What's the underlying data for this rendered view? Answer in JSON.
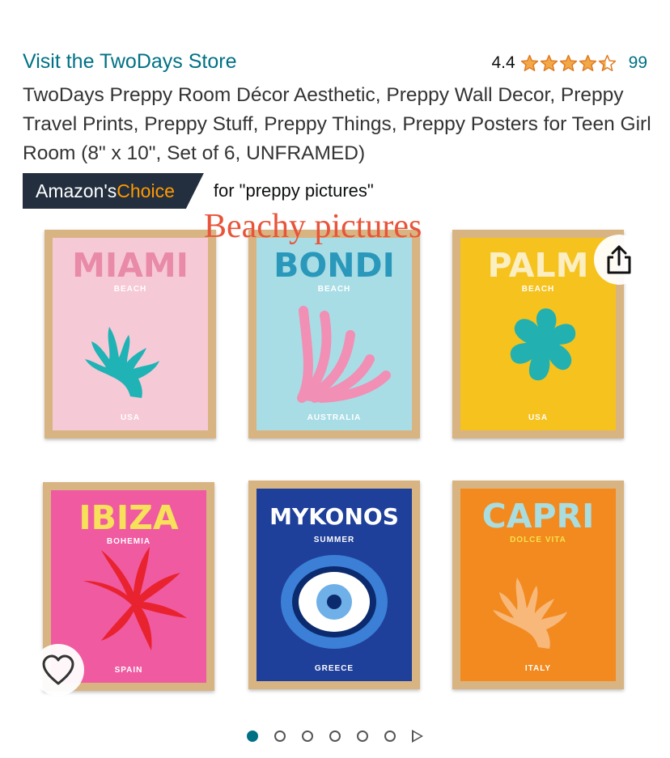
{
  "store": {
    "link_text": "Visit the TwoDays Store"
  },
  "rating": {
    "value": "4.4",
    "stars": 4.4,
    "count": "99",
    "star_color": "#f3a847"
  },
  "product": {
    "title": "TwoDays Preppy Room Décor Aesthetic, Preppy Wall Decor, Preppy Travel Prints, Preppy Stuff, Preppy Things, Preppy Posters for Teen Girl Room (8\" x 10\",   Set of 6, UNFRAMED)"
  },
  "badge": {
    "prefix": "Amazon's ",
    "highlight": "Choice",
    "query": "for \"preppy pictures\""
  },
  "overlay": {
    "text": "Beachy pictures"
  },
  "posters": [
    {
      "name": "MIAMI",
      "sub": "BEACH",
      "bottom": "USA",
      "bg": "#f6c9d6",
      "title_color": "#e88aa8",
      "art": "coral",
      "art_color": "#1fb3b5"
    },
    {
      "name": "BONDI",
      "sub": "BEACH",
      "bottom": "AUSTRALIA",
      "bg": "#a9dde6",
      "title_color": "#2a98bb",
      "art": "coral2",
      "art_color": "#f28fb5"
    },
    {
      "name": "PALM",
      "sub": "BEACH",
      "bottom": "USA",
      "bg": "#f6c21d",
      "title_color": "#fbeec0",
      "art": "blob",
      "art_color": "#22b1b0"
    },
    {
      "name": "IBIZA",
      "sub": "BOHEMIA",
      "bottom": "SPAIN",
      "bg": "#ef5aa0",
      "title_color": "#f7e05a",
      "art": "star",
      "art_color": "#e8232f"
    },
    {
      "name": "MYKONOS",
      "sub": "SUMMER",
      "bottom": "GREECE",
      "bg": "#1e3f9a",
      "title_color": "#ffffff",
      "art": "eye",
      "art_color": "#3b7fd6"
    },
    {
      "name": "CAPRI",
      "sub": "DOLCE VITA",
      "bottom": "ITALY",
      "bg": "#f28a1f",
      "title_color": "#a9dde0",
      "art": "coral",
      "art_color": "#f7b87a"
    }
  ],
  "carousel": {
    "total_dots": 6,
    "active_index": 0
  }
}
